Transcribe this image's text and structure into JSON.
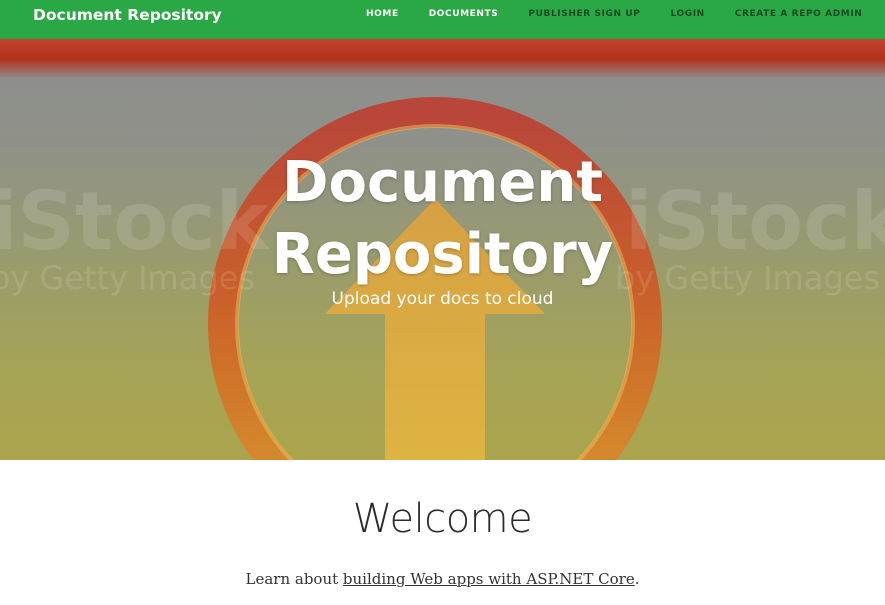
{
  "navbar": {
    "brand": "Document Repository",
    "links": [
      "HOME",
      "DOCUMENTS",
      "PUBLISHER SIGN UP",
      "LOGIN",
      "CREATE A REPO ADMIN"
    ],
    "brand_color": "#ffffff",
    "bg_color": "#2aa845"
  },
  "hero": {
    "title_line1": "Document",
    "title_line2": "Repository",
    "subtitle": "Upload your docs to cloud",
    "watermark_left": "iStock",
    "watermark_right": "iStock",
    "watermark_sub_left": "by Getty Images",
    "watermark_sub_right": "by Getty Images",
    "image_icon": "upload-arrow-circle-icon"
  },
  "main": {
    "welcome": "Welcome",
    "learn_prefix": "Learn about ",
    "learn_link": "building Web apps with ASP.NET Core",
    "learn_suffix": "."
  }
}
